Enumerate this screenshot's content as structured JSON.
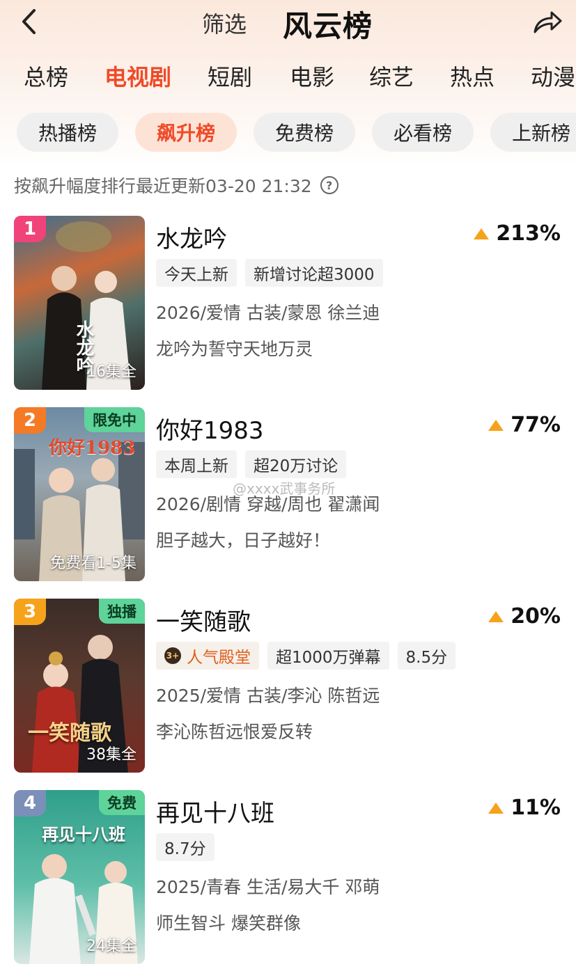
{
  "header": {
    "filter_label": "筛选",
    "title": "风云榜"
  },
  "category_tabs": [
    "总榜",
    "电视剧",
    "短剧",
    "电影",
    "综艺",
    "热点",
    "动漫"
  ],
  "active_category": "电视剧",
  "sub_tabs": [
    "热播榜",
    "飙升榜",
    "免费榜",
    "必看榜",
    "上新榜"
  ],
  "active_sub_tab": "飙升榜",
  "info": {
    "text": "按飙升幅度排行最近更新03-20 21:32",
    "help_symbol": "?"
  },
  "watermark": "@xxxx武事务所",
  "items": [
    {
      "rank": "1",
      "title": "水龙吟",
      "growth": "213%",
      "tags": [
        "今天上新",
        "新增讨论超3000"
      ],
      "meta": "2026/爱情 古装/蒙恩 徐兰迪",
      "desc": "龙吟为誓守天地万灵",
      "episodes": "16集全",
      "poster_title": "水龙吟",
      "rank_color": "#f0437a"
    },
    {
      "rank": "2",
      "title": "你好1983",
      "growth": "77%",
      "tags": [
        "本周上新",
        "超20万讨论"
      ],
      "meta": "2026/剧情 穿越/周也 翟潇闻",
      "desc": "胆子越大，日子越好！",
      "episodes": "免费看1-5集",
      "corner_badge": "限免中",
      "poster_title": "你好1983",
      "rank_color": "#f57a26"
    },
    {
      "rank": "3",
      "title": "一笑随歌",
      "growth": "20%",
      "hall_tag": "人气殿堂",
      "hall_icon": "3+",
      "tags": [
        "超1000万弹幕",
        "8.5分"
      ],
      "meta": "2025/爱情 古装/李沁 陈哲远",
      "desc": "李沁陈哲远恨爱反转",
      "episodes": "38集全",
      "corner_badge": "独播",
      "poster_title": "一笑随歌",
      "rank_color": "#f7a21b"
    },
    {
      "rank": "4",
      "title": "再见十八班",
      "growth": "11%",
      "tags": [
        "8.7分"
      ],
      "meta": "2025/青春 生活/易大千 邓萌",
      "desc": "师生智斗 爆笑群像",
      "episodes": "24集全",
      "corner_badge": "免费",
      "poster_title": "再见十八班",
      "rank_color": "#7b8fb8"
    }
  ]
}
